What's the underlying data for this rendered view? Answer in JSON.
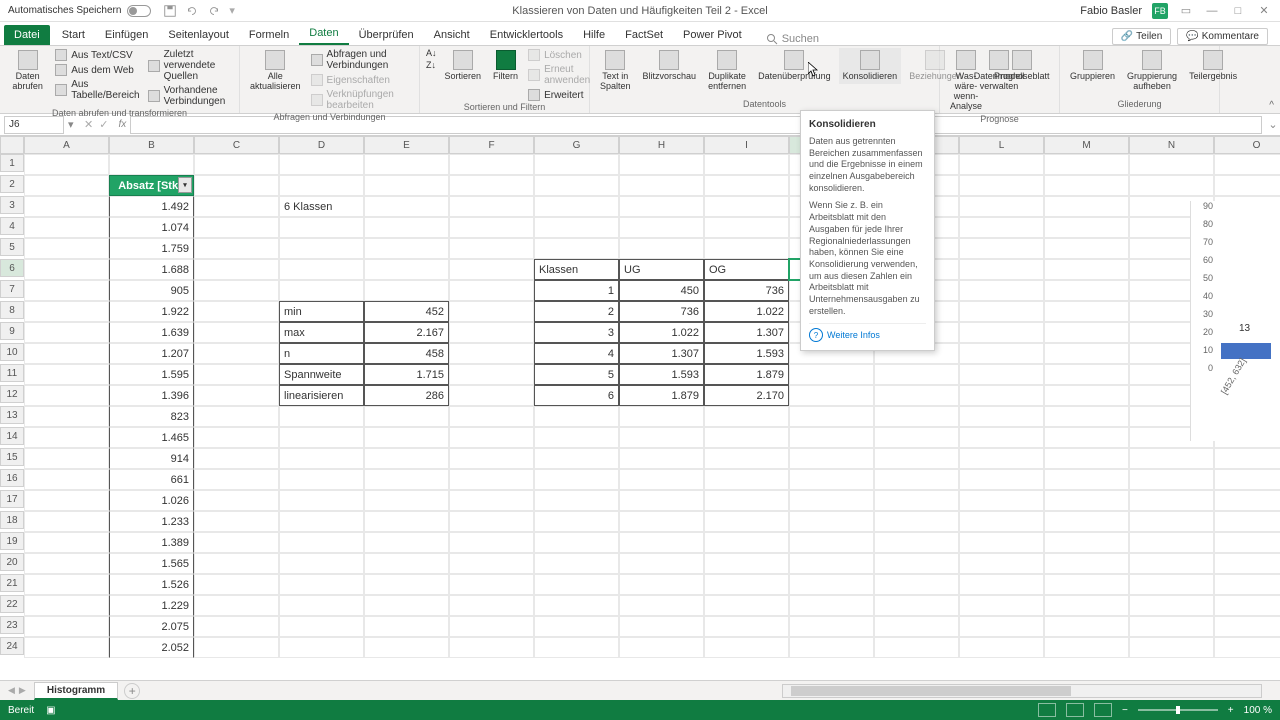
{
  "titlebar": {
    "autosave": "Automatisches Speichern",
    "doc_title": "Klassieren von Daten und Häufigkeiten Teil 2 - Excel",
    "user": "Fabio Basler",
    "avatar": "FB"
  },
  "tabs": {
    "file": "Datei",
    "items": [
      "Start",
      "Einfügen",
      "Seitenlayout",
      "Formeln",
      "Daten",
      "Überprüfen",
      "Ansicht",
      "Entwicklertools",
      "Hilfe",
      "FactSet",
      "Power Pivot"
    ],
    "active": "Daten",
    "search": "Suchen",
    "share": "Teilen",
    "comments": "Kommentare"
  },
  "ribbon": {
    "g1": {
      "large": "Daten abrufen",
      "items": [
        "Aus Text/CSV",
        "Aus dem Web",
        "Aus Tabelle/Bereich",
        "Zuletzt verwendete Quellen",
        "Vorhandene Verbindungen"
      ],
      "label": "Daten abrufen und transformieren"
    },
    "g2": {
      "large": "Alle aktualisieren",
      "items": [
        "Abfragen und Verbindungen",
        "Eigenschaften",
        "Verknüpfungen bearbeiten"
      ],
      "label": "Abfragen und Verbindungen"
    },
    "g3": {
      "sort": "Sortieren",
      "filter": "Filtern",
      "items": [
        "Löschen",
        "Erneut anwenden",
        "Erweitert"
      ],
      "label": "Sortieren und Filtern"
    },
    "g4": {
      "items": [
        "Text in Spalten",
        "Blitzvorschau",
        "Duplikate entfernen",
        "Datenüberprüfung",
        "Konsolidieren",
        "Beziehungen",
        "Datenmodell verwalten"
      ],
      "label": "Datentools"
    },
    "g5": {
      "items": [
        "Was-wäre-wenn-Analyse",
        "Prognoseblatt"
      ],
      "label": "Prognose"
    },
    "g6": {
      "items": [
        "Gruppieren",
        "Gruppierung aufheben",
        "Teilergebnis"
      ],
      "label": "Gliederung"
    }
  },
  "tooltip": {
    "title": "Konsolidieren",
    "body1": "Daten aus getrennten Bereichen zusammenfassen und die Ergebnisse in einem einzelnen Ausgabebereich konsolidieren.",
    "body2": "Wenn Sie z. B. ein Arbeitsblatt mit den Ausgaben für jede Ihrer Regionalniederlassungen haben, können Sie eine Konsolidierung verwenden, um aus diesen Zahlen ein Arbeitsblatt mit Unternehmensausgaben zu erstellen.",
    "more": "Weitere Infos"
  },
  "namebox": "J6",
  "columns": [
    "A",
    "B",
    "C",
    "D",
    "E",
    "F",
    "G",
    "H",
    "I",
    "J",
    "K",
    "L",
    "M",
    "N",
    "O"
  ],
  "grid": {
    "b2": "Absatz  [Stk.]",
    "col_b": [
      "1.492",
      "1.074",
      "1.759",
      "1.688",
      "905",
      "1.922",
      "1.639",
      "1.207",
      "1.595",
      "1.396",
      "823",
      "1.465",
      "914",
      "661",
      "1.026",
      "1.233",
      "1.389",
      "1.565",
      "1.526",
      "1.229",
      "2.075",
      "2.052"
    ],
    "d3": "6 Klassen",
    "stats": [
      {
        "label": "min",
        "val": "452"
      },
      {
        "label": "max",
        "val": "2.167"
      },
      {
        "label": "n",
        "val": "458"
      },
      {
        "label": "Spannweite",
        "val": "1.715"
      },
      {
        "label": "linearisieren",
        "val": "286"
      }
    ],
    "klassen_hdr": [
      "Klassen",
      "UG",
      "OG"
    ],
    "klassen": [
      [
        "1",
        "450",
        "736"
      ],
      [
        "2",
        "736",
        "1.022"
      ],
      [
        "3",
        "1.022",
        "1.307"
      ],
      [
        "4",
        "1.307",
        "1.593"
      ],
      [
        "5",
        "1.593",
        "1.879"
      ],
      [
        "6",
        "1.879",
        "2.170"
      ]
    ]
  },
  "chart_data": {
    "type": "bar",
    "categories": [
      "[452, 632]"
    ],
    "values": [
      13
    ],
    "ylim": [
      0,
      90
    ],
    "yticks": [
      90,
      80,
      70,
      60,
      50,
      40,
      30,
      20,
      10,
      0
    ],
    "note": "chart is clipped at right edge of viewport; only first bar and partial axis visible"
  },
  "sheet": {
    "name": "Histogramm"
  },
  "status": {
    "ready": "Bereit",
    "zoom": "100 %"
  }
}
